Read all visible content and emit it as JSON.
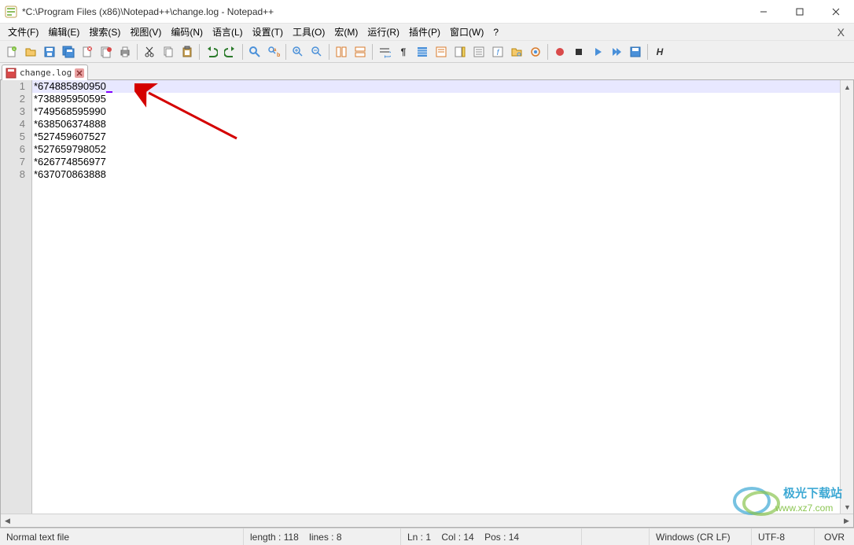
{
  "window": {
    "title": "*C:\\Program Files (x86)\\Notepad++\\change.log - Notepad++"
  },
  "menu": {
    "items": [
      "文件(F)",
      "编辑(E)",
      "搜索(S)",
      "视图(V)",
      "编码(N)",
      "语言(L)",
      "设置(T)",
      "工具(O)",
      "宏(M)",
      "运行(R)",
      "插件(P)",
      "窗口(W)",
      "?"
    ],
    "close_doc": "X"
  },
  "tabs": {
    "active": {
      "label": "change.log"
    }
  },
  "editor": {
    "lines": [
      "*674885890950",
      "*738895950595",
      "*749568595990",
      "*638506374888",
      "*527459607527",
      "*527659798052",
      "*626774856977",
      "*637070863888"
    ],
    "line_numbers": [
      "1",
      "2",
      "3",
      "4",
      "5",
      "6",
      "7",
      "8"
    ],
    "current_line_index": 0
  },
  "status": {
    "filetype": "Normal text file",
    "length_label": "length : 118",
    "lines_label": "lines : 8",
    "ln_label": "Ln : 1",
    "col_label": "Col : 14",
    "pos_label": "Pos : 14",
    "eol": "Windows (CR LF)",
    "encoding": "UTF-8",
    "insert_mode": "OVR"
  },
  "watermark": {
    "line1": "极光下载站",
    "line2": "www.xz7.com"
  }
}
